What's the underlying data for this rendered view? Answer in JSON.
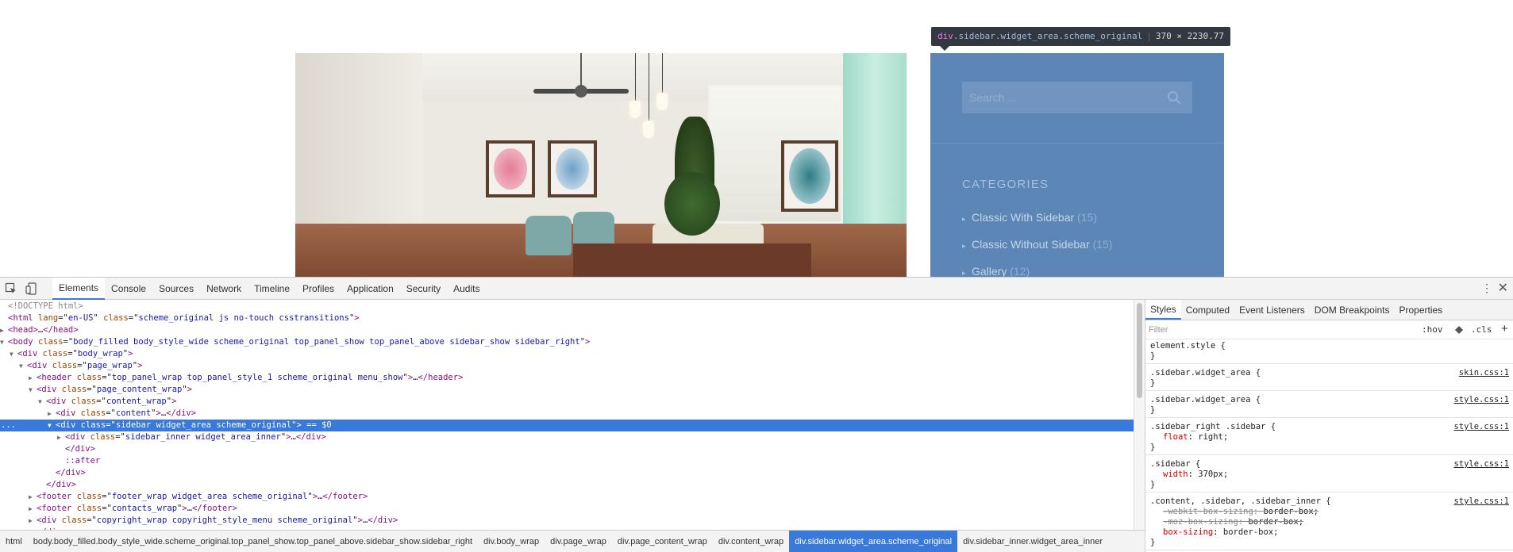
{
  "page": {
    "tooltip": {
      "tag": "div",
      "classes": ".sidebar.widget_area.scheme_original",
      "dims": "370 × 2230.77"
    },
    "sidebar": {
      "search_placeholder": "Search ...",
      "categories_title": "CATEGORIES",
      "categories": [
        {
          "label": "Classic With Sidebar",
          "count": "(15)"
        },
        {
          "label": "Classic Without Sidebar",
          "count": "(15)"
        },
        {
          "label": "Gallery",
          "count": "(12)"
        }
      ]
    }
  },
  "devtools": {
    "tabs": [
      "Elements",
      "Console",
      "Sources",
      "Network",
      "Timeline",
      "Profiles",
      "Application",
      "Security",
      "Audits"
    ],
    "active_tab": "Elements",
    "styles_tabs": [
      "Styles",
      "Computed",
      "Event Listeners",
      "DOM Breakpoints",
      "Properties"
    ],
    "filter_placeholder": "Filter",
    "hov_label": ":hov",
    "cls_label": ".cls",
    "plus_label": "+",
    "dom_lines": [
      {
        "indent": 0,
        "tri": "",
        "parts": [
          [
            "c",
            "<!DOCTYPE html>"
          ]
        ]
      },
      {
        "indent": 0,
        "tri": "",
        "parts": [
          [
            "t",
            "<html"
          ],
          [
            "x",
            " "
          ],
          [
            "a",
            "lang"
          ],
          [
            "x",
            "=\""
          ],
          [
            "v",
            "en-US"
          ],
          [
            "x",
            "\" "
          ],
          [
            "a",
            "class"
          ],
          [
            "x",
            "=\""
          ],
          [
            "v",
            "scheme_original js no-touch csstransitions"
          ],
          [
            "x",
            "\""
          ],
          [
            "t",
            ">"
          ]
        ]
      },
      {
        "indent": 0,
        "tri": "▶",
        "parts": [
          [
            "t",
            "<head>"
          ],
          [
            "x",
            "…"
          ],
          [
            "t",
            "</head>"
          ]
        ]
      },
      {
        "indent": 0,
        "tri": "▼",
        "parts": [
          [
            "t",
            "<body"
          ],
          [
            "x",
            " "
          ],
          [
            "a",
            "class"
          ],
          [
            "x",
            "=\""
          ],
          [
            "v",
            "body_filled body_style_wide scheme_original top_panel_show top_panel_above sidebar_show sidebar_right"
          ],
          [
            "x",
            "\""
          ],
          [
            "t",
            ">"
          ]
        ]
      },
      {
        "indent": 1,
        "tri": "▼",
        "parts": [
          [
            "t",
            "<div"
          ],
          [
            "x",
            " "
          ],
          [
            "a",
            "class"
          ],
          [
            "x",
            "=\""
          ],
          [
            "v",
            "body_wrap"
          ],
          [
            "x",
            "\""
          ],
          [
            "t",
            ">"
          ]
        ]
      },
      {
        "indent": 2,
        "tri": "▼",
        "parts": [
          [
            "t",
            "<div"
          ],
          [
            "x",
            " "
          ],
          [
            "a",
            "class"
          ],
          [
            "x",
            "=\""
          ],
          [
            "v",
            "page_wrap"
          ],
          [
            "x",
            "\""
          ],
          [
            "t",
            ">"
          ]
        ]
      },
      {
        "indent": 3,
        "tri": "▶",
        "parts": [
          [
            "t",
            "<header"
          ],
          [
            "x",
            " "
          ],
          [
            "a",
            "class"
          ],
          [
            "x",
            "=\""
          ],
          [
            "v",
            "top_panel_wrap top_panel_style_1 scheme_original menu_show"
          ],
          [
            "x",
            "\""
          ],
          [
            "t",
            ">"
          ],
          [
            "x",
            "…"
          ],
          [
            "t",
            "</header>"
          ]
        ]
      },
      {
        "indent": 3,
        "tri": "▼",
        "parts": [
          [
            "t",
            "<div"
          ],
          [
            "x",
            " "
          ],
          [
            "a",
            "class"
          ],
          [
            "x",
            "=\""
          ],
          [
            "v",
            "page_content_wrap"
          ],
          [
            "x",
            "\""
          ],
          [
            "t",
            ">"
          ]
        ]
      },
      {
        "indent": 4,
        "tri": "▼",
        "parts": [
          [
            "t",
            "<div"
          ],
          [
            "x",
            " "
          ],
          [
            "a",
            "class"
          ],
          [
            "x",
            "=\""
          ],
          [
            "v",
            "content_wrap"
          ],
          [
            "x",
            "\""
          ],
          [
            "t",
            ">"
          ]
        ]
      },
      {
        "indent": 5,
        "tri": "▶",
        "parts": [
          [
            "t",
            "<div"
          ],
          [
            "x",
            " "
          ],
          [
            "a",
            "class"
          ],
          [
            "x",
            "=\""
          ],
          [
            "v",
            "content"
          ],
          [
            "x",
            "\""
          ],
          [
            "t",
            ">"
          ],
          [
            "x",
            "…"
          ],
          [
            "t",
            "</div>"
          ]
        ]
      },
      {
        "indent": 5,
        "tri": "▼",
        "selected": true,
        "parts": [
          [
            "t",
            "<div"
          ],
          [
            "x",
            " "
          ],
          [
            "a",
            "class"
          ],
          [
            "x",
            "=\""
          ],
          [
            "v",
            "sidebar widget_area scheme_original"
          ],
          [
            "x",
            "\""
          ],
          [
            "t",
            ">"
          ],
          [
            "x",
            " == $0"
          ]
        ]
      },
      {
        "indent": 6,
        "tri": "▶",
        "parts": [
          [
            "t",
            "<div"
          ],
          [
            "x",
            " "
          ],
          [
            "a",
            "class"
          ],
          [
            "x",
            "=\""
          ],
          [
            "v",
            "sidebar_inner widget_area_inner"
          ],
          [
            "x",
            "\""
          ],
          [
            "t",
            ">"
          ],
          [
            "x",
            "…"
          ],
          [
            "t",
            "</div>"
          ]
        ]
      },
      {
        "indent": 6,
        "tri": "",
        "parts": [
          [
            "t",
            "</div>"
          ]
        ]
      },
      {
        "indent": 6,
        "tri": "",
        "parts": [
          [
            "t",
            "::after"
          ]
        ]
      },
      {
        "indent": 5,
        "tri": "",
        "parts": [
          [
            "t",
            "</div>"
          ]
        ]
      },
      {
        "indent": 4,
        "tri": "",
        "parts": [
          [
            "t",
            "</div>"
          ]
        ]
      },
      {
        "indent": 3,
        "tri": "▶",
        "parts": [
          [
            "t",
            "<footer"
          ],
          [
            "x",
            " "
          ],
          [
            "a",
            "class"
          ],
          [
            "x",
            "=\""
          ],
          [
            "v",
            "footer_wrap widget_area scheme_original"
          ],
          [
            "x",
            "\""
          ],
          [
            "t",
            ">"
          ],
          [
            "x",
            "…"
          ],
          [
            "t",
            "</footer>"
          ]
        ]
      },
      {
        "indent": 3,
        "tri": "▶",
        "parts": [
          [
            "t",
            "<footer"
          ],
          [
            "x",
            " "
          ],
          [
            "a",
            "class"
          ],
          [
            "x",
            "=\""
          ],
          [
            "v",
            "contacts_wrap"
          ],
          [
            "x",
            "\""
          ],
          [
            "t",
            ">"
          ],
          [
            "x",
            "…"
          ],
          [
            "t",
            "</footer>"
          ]
        ]
      },
      {
        "indent": 3,
        "tri": "▶",
        "parts": [
          [
            "t",
            "<div"
          ],
          [
            "x",
            " "
          ],
          [
            "a",
            "class"
          ],
          [
            "x",
            "=\""
          ],
          [
            "v",
            "copyright_wrap copyright_style_menu scheme_original"
          ],
          [
            "x",
            "\""
          ],
          [
            "t",
            ">"
          ],
          [
            "x",
            "…"
          ],
          [
            "t",
            "</div>"
          ]
        ]
      },
      {
        "indent": 3,
        "tri": "",
        "parts": [
          [
            "t",
            "</div>"
          ]
        ]
      }
    ],
    "selected_marker": "...",
    "style_rules": [
      {
        "selector": "element.style {",
        "source": "",
        "decls": []
      },
      {
        "selector": ".sidebar.widget_area {",
        "source": "skin.css:1",
        "decls": []
      },
      {
        "selector": ".sidebar.widget_area {",
        "source": "style.css:1",
        "decls": []
      },
      {
        "selector": ".sidebar_right .sidebar {",
        "source": "style.css:1",
        "decls": [
          {
            "prop": "float",
            "val": "right;",
            "strike": false
          }
        ]
      },
      {
        "selector": ".sidebar {",
        "source": "style.css:1",
        "decls": [
          {
            "prop": "width",
            "val": "370px;",
            "strike": false
          }
        ]
      },
      {
        "selector": ".content, .sidebar, .sidebar_inner {",
        "source": "style.css:1",
        "decls": [
          {
            "prop": "-webkit-box-sizing",
            "val": "border-box;",
            "strike": true
          },
          {
            "prop": "-moz-box-sizing",
            "val": "border-box;",
            "strike": true
          },
          {
            "prop": "box-sizing",
            "val": "border-box;",
            "strike": false
          }
        ]
      }
    ],
    "breadcrumbs": [
      "html",
      "body.body_filled.body_style_wide.scheme_original.top_panel_show.top_panel_above.sidebar_show.sidebar_right",
      "div.body_wrap",
      "div.page_wrap",
      "div.page_content_wrap",
      "div.content_wrap",
      "div.sidebar.widget_area.scheme_original",
      "div.sidebar_inner.widget_area_inner"
    ],
    "active_breadcrumb": 6
  },
  "colors": {
    "selection": "#3879d9",
    "sidebar_highlight": "#5c86b5",
    "tag": "#881280",
    "attr_name": "#994500",
    "attr_value": "#1a1aa6"
  }
}
